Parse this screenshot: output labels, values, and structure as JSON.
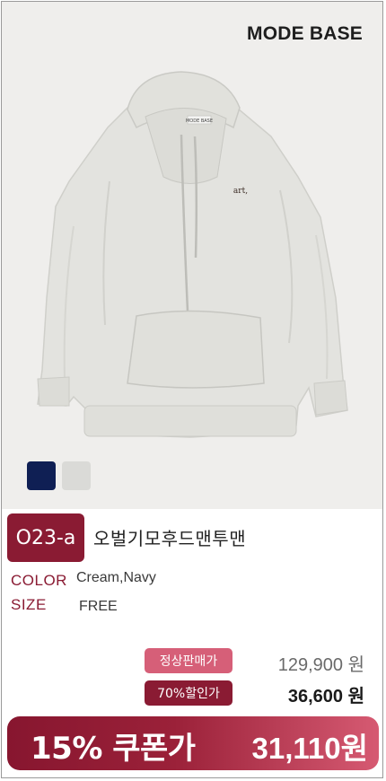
{
  "brand": "MODE BASE",
  "product": {
    "code": "O23-a",
    "name": "오벌기모후드맨투맨",
    "hoodie_label": "art,",
    "neck_tag": "MODE BASE"
  },
  "swatches": [
    {
      "name": "Navy",
      "color": "#0f1f54"
    },
    {
      "name": "Cream",
      "color": "#dadad7"
    }
  ],
  "specs": {
    "color_label": "COLOR",
    "color_value": "Cream,Navy",
    "size_label": "SIZE",
    "size_value": "FREE"
  },
  "pricing": {
    "regular_label": "정상판매가",
    "regular_price": "129,900 원",
    "sale_label": "70%할인가",
    "sale_price": "36,600 원",
    "coupon_label": "15% 쿠폰가",
    "coupon_price": "31,110원"
  },
  "colors": {
    "accent": "#8a1b33",
    "accent_light": "#d65f78"
  }
}
